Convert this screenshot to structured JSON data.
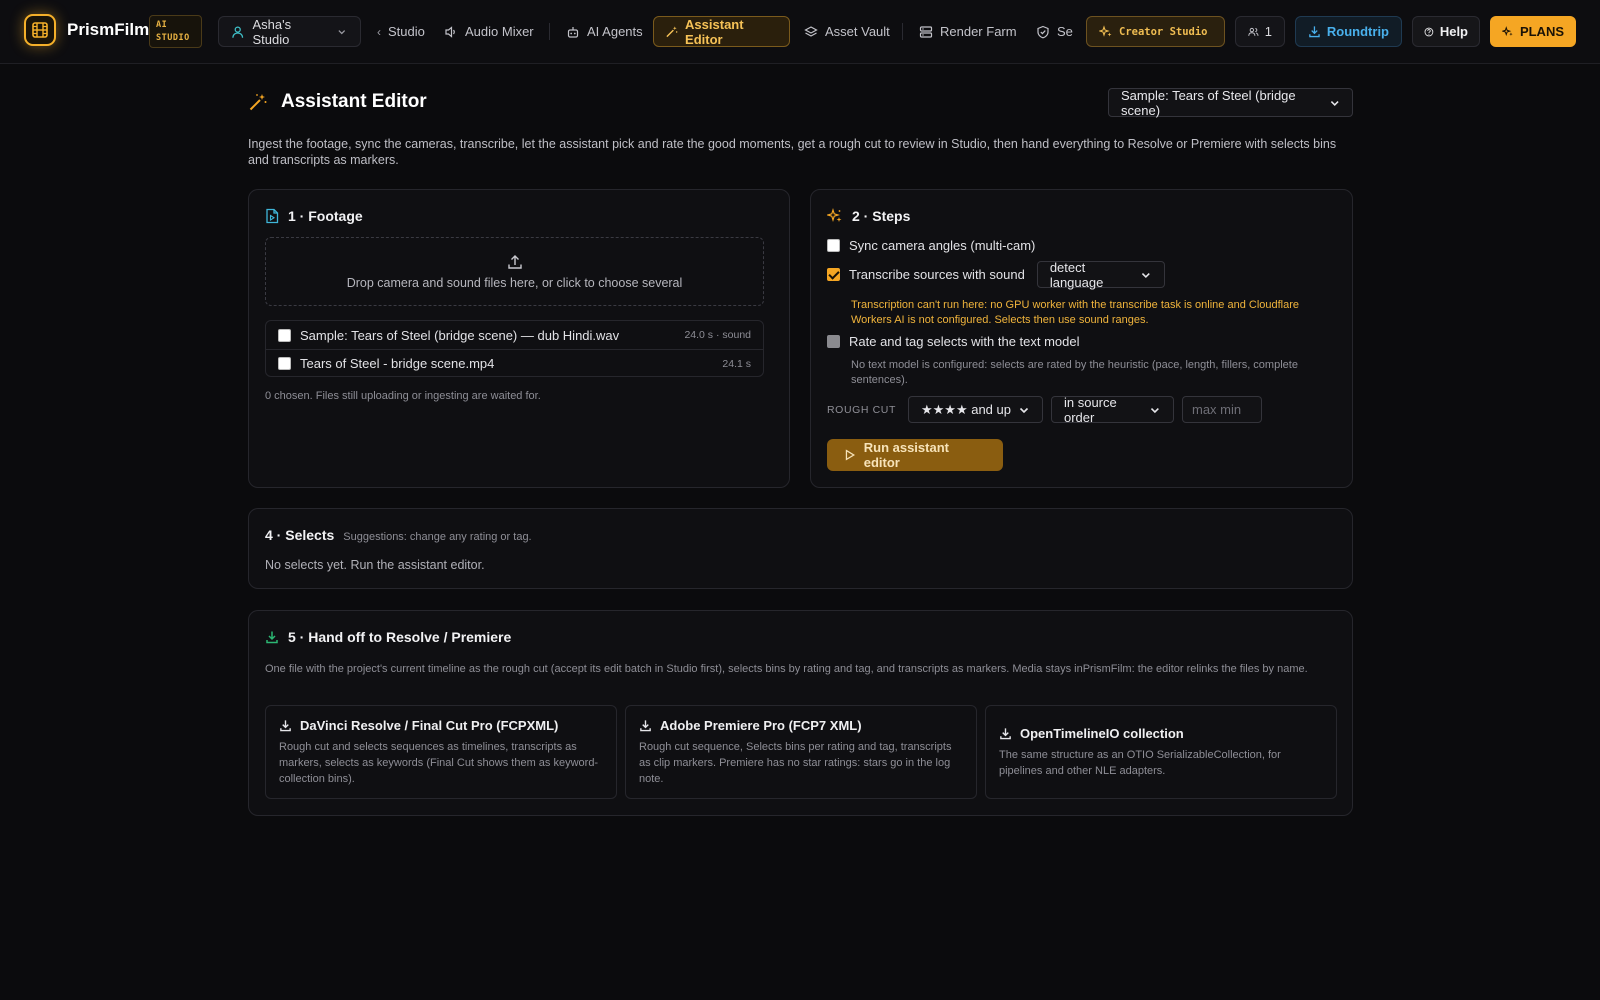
{
  "app": {
    "brand": "PrismFilm",
    "badge_line1": "AI",
    "badge_line2": "STUDIO"
  },
  "nav": {
    "workspace": "Asha's Studio",
    "items": [
      {
        "label": "Studio",
        "icon": "chevron-left-icon"
      },
      {
        "label": "Audio Mixer",
        "icon": "speaker-icon"
      },
      {
        "label": "AI Agents",
        "icon": "robot-icon"
      },
      {
        "label": "Assistant Editor",
        "icon": "magic-wand-icon",
        "active": true
      },
      {
        "label": "Asset Vault",
        "icon": "layers-icon"
      },
      {
        "label": "Render Farm",
        "icon": "server-icon"
      },
      {
        "label": "Se",
        "icon": "shield-icon"
      }
    ],
    "creator_studio": "Creator Studio",
    "users_count": "1",
    "roundtrip": "Roundtrip",
    "help": "Help",
    "plans": "PLANS"
  },
  "page": {
    "title": "Assistant Editor",
    "sample_select": "Sample: Tears of Steel (bridge scene)",
    "intro": "Ingest the footage, sync the cameras, transcribe, let the assistant pick and rate the good moments, get a rough cut to review in Studio, then hand everything to Resolve or Premiere with selects bins and transcripts as markers."
  },
  "footage": {
    "title": "1 · Footage",
    "dropzone": "Drop camera and sound files here, or click to choose several",
    "files": [
      {
        "name": "Sample: Tears of Steel (bridge scene) — dub Hindi.wav",
        "meta": "24.0 s · sound"
      },
      {
        "name": "Tears of Steel - bridge scene.mp4",
        "meta": "24.1 s"
      }
    ],
    "chosen_note": "0 chosen. Files still uploading or ingesting are waited for."
  },
  "steps": {
    "title": "2 · Steps",
    "sync_label": "Sync camera angles (multi-cam)",
    "transcribe_label": "Transcribe sources with sound",
    "language_select": "detect language",
    "transcribe_warning": "Transcription can't run here: no GPU worker with the transcribe task is online and Cloudflare Workers AI is not configured. Selects then use sound ranges.",
    "rate_label": "Rate and tag selects with the text model",
    "rate_note": "No text model is configured: selects are rated by the heuristic (pace, length, fillers, complete sentences).",
    "rough_cut_label": "ROUGH CUT",
    "rating_select": "★★★★ and up",
    "order_select": "in source order",
    "max_min_placeholder": "max min",
    "run_button": "Run assistant editor"
  },
  "selects": {
    "title": "4 · Selects",
    "subtitle": "Suggestions: change any rating or tag.",
    "empty": "No selects yet. Run the assistant editor."
  },
  "handoff": {
    "title": "5 · Hand off to Resolve / Premiere",
    "desc": "One file with the project's current timeline as the rough cut (accept its edit batch in Studio first), selects bins by rating and tag, and transcripts as markers. Media stays inPrismFilm: the editor relinks the files by name.",
    "exports": [
      {
        "title": "DaVinci Resolve / Final Cut Pro (FCPXML)",
        "desc": "Rough cut and selects sequences as timelines, transcripts as markers, selects as keywords (Final Cut shows them as keyword-collection bins)."
      },
      {
        "title": "Adobe Premiere Pro (FCP7 XML)",
        "desc": "Rough cut sequence, Selects bins per rating and tag, transcripts as clip markers. Premiere has no star ratings: stars go in the log note."
      },
      {
        "title": "OpenTimelineIO collection",
        "desc": "The same structure as an OTIO SerializableCollection, for pipelines and other NLE adapters."
      }
    ]
  },
  "colors": {
    "accent": "#f5a623",
    "accent_text": "#f6c257",
    "link_blue": "#49b0ec",
    "warning": "#f0b43c",
    "success_icon": "#2bb673"
  }
}
